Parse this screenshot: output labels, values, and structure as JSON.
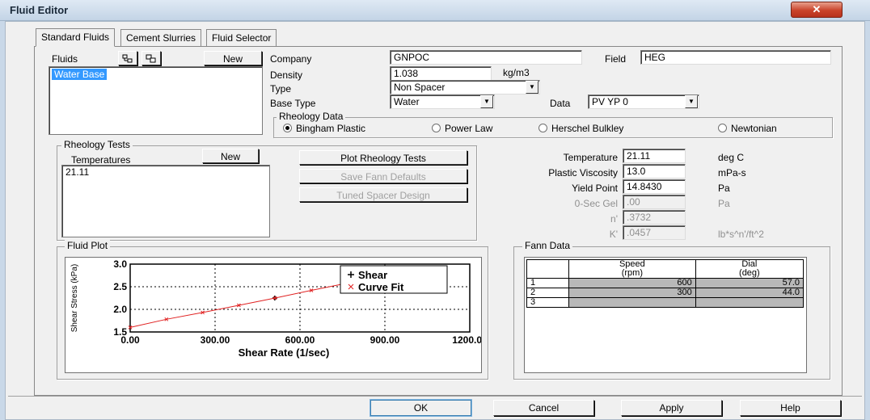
{
  "window": {
    "title": "Fluid Editor",
    "close_glyph": "✕"
  },
  "tabs": [
    {
      "label": "Standard Fluids"
    },
    {
      "label": "Cement Slurries"
    },
    {
      "label": "Fluid Selector"
    }
  ],
  "fluids": {
    "label": "Fluids",
    "new_label": "New",
    "items": [
      "Water Base"
    ],
    "icons": [
      "delete-fluid-icon",
      "copy-fluid-icon"
    ]
  },
  "company": {
    "label": "Company",
    "value": "GNPOC"
  },
  "field": {
    "label": "Field",
    "value": "HEG"
  },
  "density": {
    "label": "Density",
    "value": "1.038",
    "unit": "kg/m3"
  },
  "type": {
    "label": "Type",
    "value": "Non Spacer"
  },
  "base_type": {
    "label": "Base Type",
    "value": "Water"
  },
  "data": {
    "label": "Data",
    "value": "PV YP 0"
  },
  "rheology_data": {
    "title": "Rheology Data",
    "options": [
      "Bingham Plastic",
      "Power Law",
      "Herschel Bulkley",
      "Newtonian"
    ],
    "selected": "Bingham Plastic"
  },
  "rheology_tests": {
    "title": "Rheology Tests",
    "temps_label": "Temperatures",
    "new_label": "New",
    "items": [
      "21.11"
    ]
  },
  "buttons": {
    "plot": "Plot Rheology Tests",
    "save_fann": "Save Fann Defaults",
    "tuned_spacer": "Tuned Spacer Design"
  },
  "params": {
    "temperature": {
      "label": "Temperature",
      "value": "21.11",
      "unit": "deg C"
    },
    "pv": {
      "label": "Plastic Viscosity",
      "value": "13.0",
      "unit": "mPa-s"
    },
    "yp": {
      "label": "Yield Point",
      "value": "14.8430",
      "unit": "Pa"
    },
    "gel": {
      "label": "0-Sec Gel",
      "value": ".00",
      "unit": "Pa"
    },
    "n": {
      "label": "n'",
      "value": ".3732"
    },
    "k": {
      "label": "K'",
      "value": ".0457",
      "unit": "lb*s^n'/ft^2"
    }
  },
  "fluid_plot": {
    "title": "Fluid Plot"
  },
  "chart_data": {
    "type": "scatter",
    "xlabel": "Shear Rate (1/sec)",
    "ylabel": "Shear Stress (kPa)",
    "xlim": [
      0,
      1200
    ],
    "ylim": [
      1.5,
      3.0
    ],
    "xticks": [
      "0.00",
      "300.00",
      "600.00",
      "900.00",
      "1200.00"
    ],
    "yticks": [
      "1.5",
      "2.0",
      "2.5",
      "3.0"
    ],
    "grid": true,
    "legend": "top-right",
    "series": [
      {
        "name": "Shear",
        "marker": "+",
        "color": "#000000",
        "points": [
          [
            511,
            2.25
          ],
          [
            1022,
            2.9
          ]
        ]
      },
      {
        "name": "Curve Fit",
        "marker": "x",
        "color": "#e02020",
        "points": [
          [
            0,
            1.6
          ],
          [
            128,
            1.78
          ],
          [
            256,
            1.93
          ],
          [
            384,
            2.09
          ],
          [
            512,
            2.25
          ],
          [
            640,
            2.42
          ],
          [
            768,
            2.58
          ],
          [
            896,
            2.74
          ],
          [
            1022,
            2.9
          ]
        ]
      }
    ]
  },
  "fann_data": {
    "title": "Fann Data",
    "columns": [
      [
        "Speed",
        "(rpm)"
      ],
      [
        "Dial",
        "(deg)"
      ]
    ],
    "rows": [
      {
        "num": "1",
        "speed": "600",
        "dial": "57.0"
      },
      {
        "num": "2",
        "speed": "300",
        "dial": "44.0"
      },
      {
        "num": "3",
        "speed": "",
        "dial": ""
      }
    ]
  },
  "footer": {
    "ok": "OK",
    "cancel": "Cancel",
    "apply": "Apply",
    "help": "Help"
  }
}
